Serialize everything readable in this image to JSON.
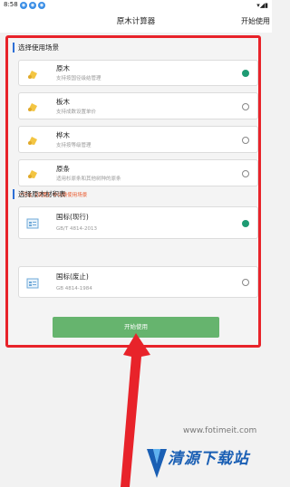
{
  "status_bar": {
    "time": "8:58",
    "right": "▾◢▮"
  },
  "app_bar": {
    "title": "原木计算器",
    "action": "开始使用"
  },
  "scene_section": {
    "title": "选择使用场景",
    "options": [
      {
        "name": "原木",
        "desc": "支持按国径级结管理",
        "selected": true,
        "icon": "log-icon"
      },
      {
        "name": "板木",
        "desc": "支持成数设置单价",
        "selected": false,
        "icon": "plank-icon"
      },
      {
        "name": "桦木",
        "desc": "支持按等级管理",
        "selected": false,
        "icon": "birch-icon"
      },
      {
        "name": "原条",
        "desc": "适用杉原条和其他树种的原条",
        "selected": false,
        "icon": "rod-icon"
      }
    ],
    "note": "*可在【设置】中切换使用场景"
  },
  "table_section": {
    "title": "选择原木材积表",
    "options": [
      {
        "name": "国标(现行)",
        "desc": "GB/T 4814-2013",
        "selected": true,
        "icon": "table-icon"
      },
      {
        "name": "国标(废止)",
        "desc": "GB 4814-1984",
        "selected": false,
        "icon": "table-icon"
      }
    ]
  },
  "start_button": "开始使用",
  "watermark": {
    "text": "清源下载站",
    "url": "www.fotimeit.com"
  },
  "colors": {
    "accent_green": "#1e9b73",
    "button_green": "#66b46e",
    "highlight_red": "#e8232a",
    "note_orange": "#e8562a",
    "section_bar_blue": "#2d6fd6"
  }
}
